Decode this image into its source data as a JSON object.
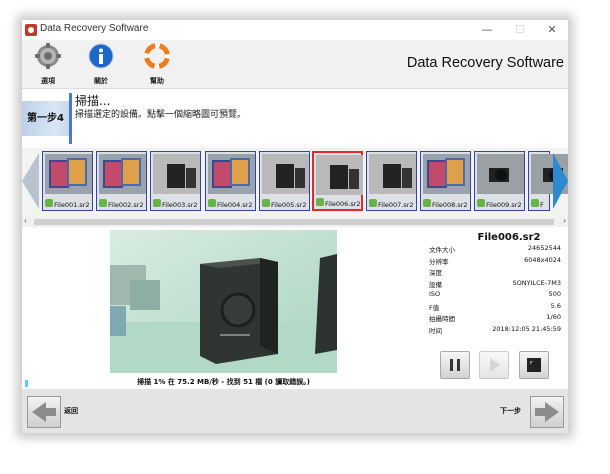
{
  "window": {
    "title": "Data Recovery Software",
    "minimize": "—",
    "maximize": "☐",
    "close": "✕"
  },
  "toolbar": {
    "options_label": "選項",
    "about_label": "關於",
    "help_label": "幫助",
    "brand": "Data Recovery Software"
  },
  "step": {
    "badge": "第一步4",
    "title": "掃描...",
    "description": "掃描選定的設備。點擊一個縮略圖可預覽。"
  },
  "thumbnails": [
    {
      "name": "File001.sr2",
      "selected": false,
      "kind": "tablets"
    },
    {
      "name": "File002.sr2",
      "selected": false,
      "kind": "tablets"
    },
    {
      "name": "File003.sr2",
      "selected": false,
      "kind": "box"
    },
    {
      "name": "File004.sr2",
      "selected": false,
      "kind": "tablets"
    },
    {
      "name": "File005.sr2",
      "selected": false,
      "kind": "box"
    },
    {
      "name": "File006.sr2",
      "selected": true,
      "kind": "box"
    },
    {
      "name": "File007.sr2",
      "selected": false,
      "kind": "box"
    },
    {
      "name": "File008.sr2",
      "selected": false,
      "kind": "tablets"
    },
    {
      "name": "File009.sr2",
      "selected": false,
      "kind": "camera"
    },
    {
      "name": "F",
      "selected": false,
      "kind": "camera"
    }
  ],
  "scrollbar": {
    "left": "‹",
    "right": "›"
  },
  "preview": {
    "status": "掃描 1% 在 75.2 MB/秒 - 找到 51 檔 (0 讀取錯誤。)",
    "progress": 0.01
  },
  "file_info": {
    "filename": "File006.sr2",
    "rows": [
      {
        "key": "文件大小",
        "value": "24652544"
      },
      {
        "key": "分辨率",
        "value": "6048x4024"
      },
      {
        "key": "深度",
        "value": ""
      },
      {
        "key": "設備",
        "value": "SONYILCE-7M3"
      },
      {
        "key": "ISO",
        "value": "500"
      },
      {
        "key": "F值",
        "value": "5.6"
      },
      {
        "key": "拍攝時間",
        "value": "1/60"
      },
      {
        "key": "时间",
        "value": "2018:12:05 21:45:59"
      }
    ]
  },
  "footer": {
    "back_label": "返回",
    "next_label": "下一步"
  },
  "colors": {
    "accent_blue": "#2d8ad1",
    "selected_border": "#e02a2a",
    "thumb_border": "#3344aa",
    "progress": "#68c8f0"
  }
}
